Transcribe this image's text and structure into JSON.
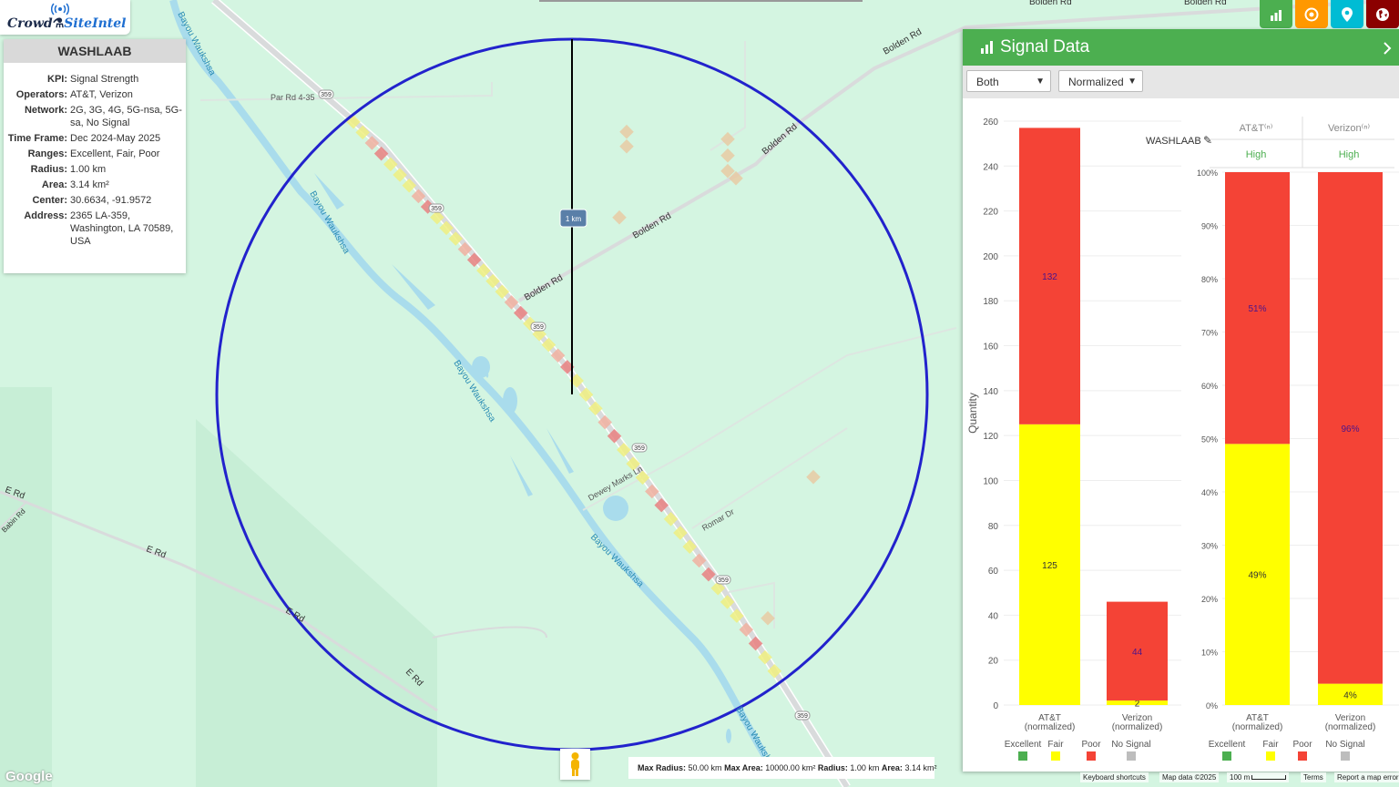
{
  "brand": {
    "crowd": "Crowd",
    "siteintel": "SiteIntel"
  },
  "info": {
    "title": "WASHLAAB",
    "rows": [
      {
        "k": "KPI:",
        "v": "Signal Strength"
      },
      {
        "k": "Operators:",
        "v": "AT&T, Verizon"
      },
      {
        "k": "Network:",
        "v": "2G, 3G, 4G, 5G-nsa, 5G-sa, No Signal"
      },
      {
        "k": "Time Frame:",
        "v": "Dec 2024-May 2025"
      },
      {
        "k": "Ranges:",
        "v": "Excellent, Fair, Poor"
      },
      {
        "k": "Radius:",
        "v": "1.00 km"
      },
      {
        "k": "Area:",
        "v": "3.14 km²"
      },
      {
        "k": "Center:",
        "v": "30.6634, -91.9572"
      },
      {
        "k": "Address:",
        "v": "2365 LA-359, Washington, LA 70589, USA"
      }
    ]
  },
  "toolbar": {
    "colors": [
      "#4caf50",
      "#ff9800",
      "#00bcd4",
      "#8b0000"
    ],
    "icons": [
      "bar-chart-icon",
      "target-icon",
      "location-pin-icon",
      "globe-icon"
    ]
  },
  "map": {
    "road_labels": [
      "Par Rd 4-35",
      "Bolden Rd",
      "Bolden Rd",
      "Bolden Rd",
      "Bolden Rd",
      "Dewey Marks Ln",
      "Romar Dr",
      "E Rd",
      "E Rd",
      "E Rd",
      "E Rd",
      "Babin Rd",
      "Bolden Rd",
      "Bolden Rd"
    ],
    "water_labels": [
      "Bayou Waukshsa",
      "Bayou Waukshsa",
      "Bayou Waukshsa",
      "Bayou Waukshsa",
      "Bayou Waukshsa",
      "Bayou Waukshsa"
    ],
    "route_shield": "359",
    "radius_label": "1 km",
    "bottom_info": {
      "max_radius_label": "Max Radius:",
      "max_radius": "50.00 km",
      "max_area_label": "Max Area:",
      "max_area": "10000.00 km²",
      "radius_label": "Radius:",
      "radius": "1.00 km",
      "area_label": "Area:",
      "area": "3.14 km²"
    },
    "google": "Google",
    "footer": {
      "shortcuts": "Keyboard shortcuts",
      "mapdata": "Map data ©2025",
      "scale": "100 m",
      "terms": "Terms",
      "report": "Report a map error"
    }
  },
  "panel": {
    "title": "Signal Data",
    "selects": {
      "operator": "Both",
      "mode": "Normalized"
    },
    "chart_title": "WASHLAAB",
    "colors": {
      "excellent": "#4caf50",
      "fair": "#ffff00",
      "poor": "#f44336",
      "nosignal": "#bdbdbd"
    },
    "legend": [
      "Excellent",
      "Fair",
      "Poor",
      "No Signal"
    ],
    "table": {
      "headers": [
        "AT&T⁽ⁿ⁾",
        "Verizon⁽ⁿ⁾"
      ],
      "values": [
        "High",
        "High"
      ]
    }
  },
  "chart_data": [
    {
      "type": "bar",
      "stacked": true,
      "title": "",
      "ylabel": "Quantity",
      "categories": [
        "AT&T\n(normalized)",
        "Verizon\n(normalized)"
      ],
      "series": [
        {
          "name": "Excellent",
          "values": [
            0,
            0
          ]
        },
        {
          "name": "Fair",
          "values": [
            125,
            2
          ]
        },
        {
          "name": "Poor",
          "values": [
            132,
            44
          ]
        },
        {
          "name": "No Signal",
          "values": [
            0,
            0
          ]
        }
      ],
      "ylim": [
        0,
        260
      ],
      "yticks": [
        0,
        20,
        40,
        60,
        80,
        100,
        120,
        140,
        160,
        180,
        200,
        220,
        240,
        260
      ],
      "legend": "bottom"
    },
    {
      "type": "bar",
      "stacked": true,
      "title": "",
      "categories": [
        "AT&T\n(normalized)",
        "Verizon\n(normalized)"
      ],
      "series": [
        {
          "name": "Excellent",
          "values": [
            0,
            0
          ]
        },
        {
          "name": "Fair",
          "values": [
            49,
            4
          ]
        },
        {
          "name": "Poor",
          "values": [
            51,
            96
          ]
        },
        {
          "name": "No Signal",
          "values": [
            0,
            0
          ]
        }
      ],
      "ylim": [
        0,
        100
      ],
      "yticks": [
        "0%",
        "10%",
        "20%",
        "30%",
        "40%",
        "50%",
        "60%",
        "70%",
        "80%",
        "90%",
        "100%"
      ],
      "legend": "bottom"
    }
  ]
}
